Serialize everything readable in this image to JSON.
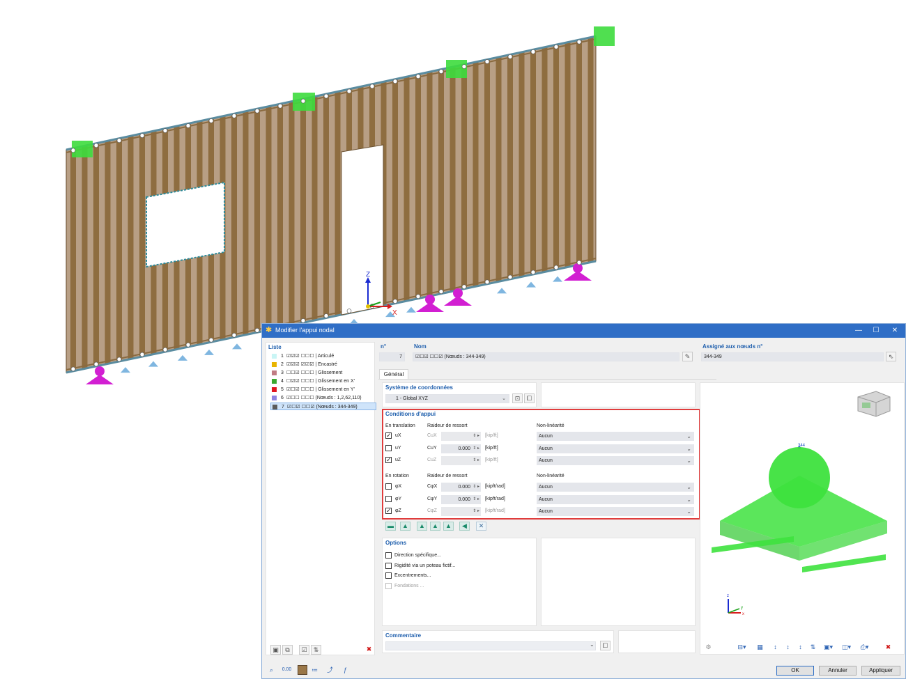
{
  "view": {
    "axis_x": "X",
    "axis_z": "Z"
  },
  "dialog": {
    "title": "Modifier l'appui nodal",
    "list": {
      "header": "Liste",
      "items": [
        {
          "num": "1",
          "label": "☑☑☑ ☐☐☐ | Articulé",
          "color": "#c9f5f5"
        },
        {
          "num": "2",
          "label": "☑☑☑ ☑☑☑ | Encastré",
          "color": "#e8b400"
        },
        {
          "num": "3",
          "label": "☐☐☑ ☐☐☐ | Glissement",
          "color": "#c07c83"
        },
        {
          "num": "4",
          "label": "☐☑☑ ☐☐☐ | Glissement en X'",
          "color": "#3aa82f"
        },
        {
          "num": "5",
          "label": "☑☐☑ ☐☐☐ | Glissement en Y'",
          "color": "#e0151f"
        },
        {
          "num": "6",
          "label": "☑☐☐ ☐☐☐ (Nœuds : 1,2,62,110)",
          "color": "#8f83e0"
        },
        {
          "num": "7",
          "label": "☑☐☑ ☐☐☑ (Nœuds : 344-349)",
          "color": "#5b5b5b"
        }
      ]
    },
    "header": {
      "no_label": "n°",
      "no_value": "7",
      "name_label": "Nom",
      "name_value": "☑☐☑ ☐☐☑ (Nœuds : 344-349)",
      "assigned_label": "Assigné aux nœuds n°",
      "assigned_value": "344-349"
    },
    "tab_general": "Général",
    "coord": {
      "title": "Système de coordonnées",
      "value": "1 - Global XYZ"
    },
    "support": {
      "title": "Conditions d'appui",
      "translation_header": "En translation",
      "spring_header": "Raideur de ressort",
      "nonlin_header": "Non-linéarité",
      "rotation_header": "En rotation",
      "translation_rows": [
        {
          "dof": "uX",
          "checked": true,
          "spring_label": "CuX",
          "spring_value": "",
          "unit": "[kip/ft]",
          "active": false,
          "nonlin": "Aucun"
        },
        {
          "dof": "uY",
          "checked": false,
          "spring_label": "CuY",
          "spring_value": "0.000",
          "unit": "[kip/ft]",
          "active": true,
          "nonlin": "Aucun"
        },
        {
          "dof": "uZ",
          "checked": true,
          "spring_label": "CuZ",
          "spring_value": "",
          "unit": "[kip/ft]",
          "active": false,
          "nonlin": "Aucun"
        }
      ],
      "rotation_rows": [
        {
          "dof": "φX",
          "checked": false,
          "spring_label": "CφX",
          "spring_value": "0.000",
          "unit": "[kipft/rad]",
          "active": true,
          "nonlin": "Aucun"
        },
        {
          "dof": "φY",
          "checked": false,
          "spring_label": "CφY",
          "spring_value": "0.000",
          "unit": "[kipft/rad]",
          "active": true,
          "nonlin": "Aucun"
        },
        {
          "dof": "φZ",
          "checked": true,
          "spring_label": "CφZ",
          "spring_value": "",
          "unit": "[kipft/rad]",
          "active": false,
          "nonlin": "Aucun"
        }
      ]
    },
    "options": {
      "title": "Options",
      "items": [
        {
          "label": "Direction spécifique...",
          "enabled": true
        },
        {
          "label": "Rigidité via un poteau fictif...",
          "enabled": true
        },
        {
          "label": "Excentrements...",
          "enabled": true
        },
        {
          "label": "Fondations ...",
          "enabled": false
        }
      ]
    },
    "comment": {
      "title": "Commentaire",
      "value": ""
    },
    "preview": {
      "node_label": "344",
      "axis_z": "z",
      "axis_x": "x",
      "axis_y": "y"
    },
    "buttons": {
      "ok": "OK",
      "cancel": "Annuler",
      "apply": "Appliquer"
    },
    "bottom_left_value": "0.00"
  },
  "colors": {
    "titlebar": "#2f6ec6",
    "highlight": "#e03c3c",
    "section_title": "#1f5fad",
    "support_green": "#3ddc3d",
    "support_magenta": "#d21fd2",
    "wall_wood": "#9a7748"
  }
}
